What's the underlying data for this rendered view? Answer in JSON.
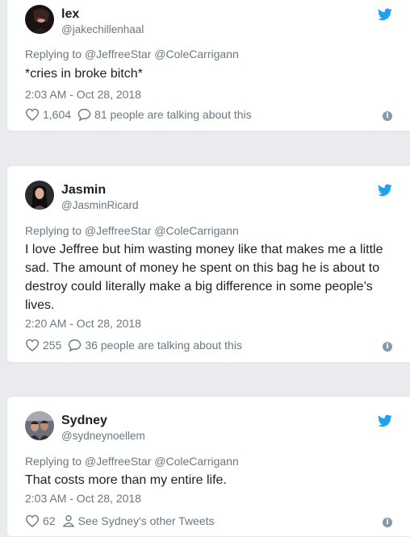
{
  "tweets": [
    {
      "name": "lex",
      "handle": "@jakechillenhaal",
      "replying": "Replying to @JeffreeStar @ColeCarrigann",
      "text": "*cries in broke bitch*",
      "time": "2:03 AM - Oct 28, 2018",
      "likes": "1,604",
      "action_text": "81 people are talking about this",
      "action_icon": "comment-bubble-icon"
    },
    {
      "name": "Jasmin",
      "handle": "@JasminRicard",
      "replying": "Replying to @JeffreeStar @ColeCarrigann",
      "text": "I love Jeffree but him wasting money like that makes me a little sad. The amount of money he spent on this bag he is about to destroy could literally make a big difference in some people’s lives.",
      "time": "2:20 AM - Oct 28, 2018",
      "likes": "255",
      "action_text": "36 people are talking about this",
      "action_icon": "comment-bubble-icon"
    },
    {
      "name": "Sydney",
      "handle": "@sydneynoellem",
      "replying": "Replying to @JeffreeStar @ColeCarrigann",
      "text": "That costs more than my entire life.",
      "time": "2:03 AM - Oct 28, 2018",
      "likes": "62",
      "action_text": "See Sydney's other Tweets",
      "action_icon": "person-icon"
    }
  ],
  "colors": {
    "brand": "#1da1f2",
    "muted": "#697882",
    "text": "#1c2022",
    "background": "#e9ebee"
  }
}
